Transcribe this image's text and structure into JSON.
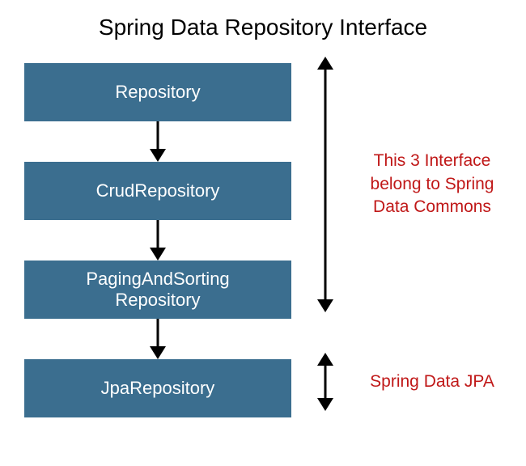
{
  "title": "Spring Data Repository Interface",
  "boxes": {
    "b1": "Repository",
    "b2": "CrudRepository",
    "b3": "PagingAndSorting\nRepository",
    "b4": "JpaRepository"
  },
  "annotations": {
    "top": "This 3 Interface belong to Spring Data Commons",
    "bottom": "Spring Data JPA"
  },
  "colors": {
    "box_bg": "#3b6e8f",
    "box_fg": "#ffffff",
    "annotation": "#c01818"
  }
}
